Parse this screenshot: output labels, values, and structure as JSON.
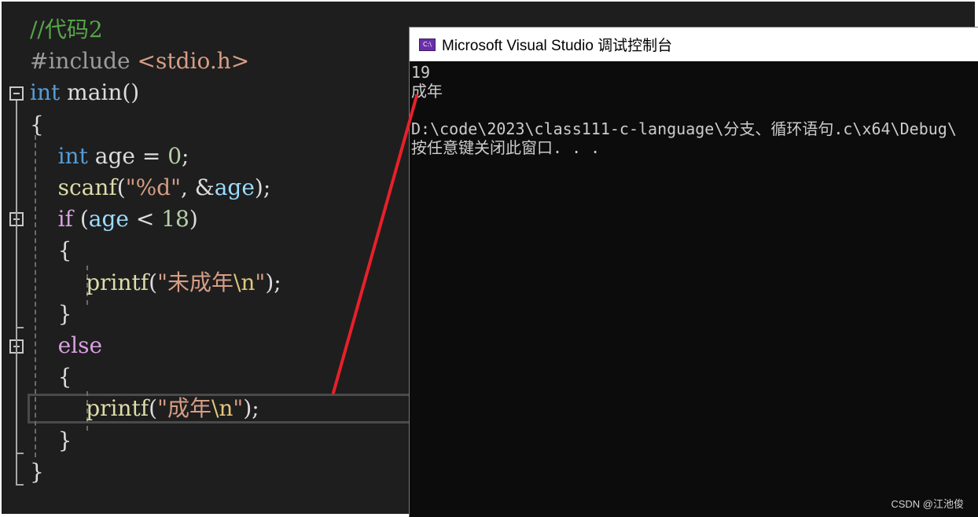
{
  "editor": {
    "lines": [
      [
        {
          "t": "//代码2",
          "c": "comment"
        }
      ],
      [
        {
          "t": "#include ",
          "c": "pre"
        },
        {
          "t": "<stdio.h>",
          "c": "str"
        }
      ],
      [
        {
          "t": "int",
          "c": "kw"
        },
        {
          "t": " main()",
          "c": "plain"
        }
      ],
      [
        {
          "t": "{",
          "c": "plain"
        }
      ],
      [
        {
          "t": "    int",
          "c": "kw"
        },
        {
          "t": " age = ",
          "c": "plain"
        },
        {
          "t": "0",
          "c": "num"
        },
        {
          "t": ";",
          "c": "plain"
        }
      ],
      [
        {
          "t": "    scanf",
          "c": "fn"
        },
        {
          "t": "(",
          "c": "plain"
        },
        {
          "t": "\"%d\"",
          "c": "str"
        },
        {
          "t": ", &",
          "c": "plain"
        },
        {
          "t": "age",
          "c": "var"
        },
        {
          "t": ");",
          "c": "plain"
        }
      ],
      [
        {
          "t": "    if",
          "c": "ctl"
        },
        {
          "t": " (",
          "c": "plain"
        },
        {
          "t": "age",
          "c": "var"
        },
        {
          "t": " < ",
          "c": "plain"
        },
        {
          "t": "18",
          "c": "num"
        },
        {
          "t": ")",
          "c": "plain"
        }
      ],
      [
        {
          "t": "    {",
          "c": "plain"
        }
      ],
      [
        {
          "t": "        printf",
          "c": "fn"
        },
        {
          "t": "(",
          "c": "plain"
        },
        {
          "t": "\"未成年",
          "c": "str"
        },
        {
          "t": "\\n",
          "c": "esc"
        },
        {
          "t": "\"",
          "c": "str"
        },
        {
          "t": ");",
          "c": "plain"
        }
      ],
      [
        {
          "t": "    }",
          "c": "plain"
        }
      ],
      [
        {
          "t": "    else",
          "c": "ctl"
        }
      ],
      [
        {
          "t": "    {",
          "c": "plain"
        }
      ],
      [
        {
          "t": "        printf",
          "c": "fn"
        },
        {
          "t": "(",
          "c": "plain"
        },
        {
          "t": "\"成年",
          "c": "str"
        },
        {
          "t": "\\n",
          "c": "esc"
        },
        {
          "t": "\"",
          "c": "str"
        },
        {
          "t": ");",
          "c": "plain"
        }
      ],
      [
        {
          "t": "    }",
          "c": "plain"
        }
      ],
      [
        {
          "t": "}",
          "c": "plain"
        }
      ]
    ]
  },
  "console": {
    "title": "Microsoft Visual Studio 调试控制台",
    "icon_label": "C:\\",
    "output_lines": [
      "19",
      "成年",
      "",
      "D:\\code\\2023\\class111-c-language\\分支、循环语句.c\\x64\\Debug\\",
      "按任意键关闭此窗口. . ."
    ]
  },
  "watermark": "CSDN @江池俊",
  "colors": {
    "annotation_arrow": "#e8202a",
    "editor_bg": "#1e1e1e",
    "console_bg": "#0c0c0c"
  }
}
